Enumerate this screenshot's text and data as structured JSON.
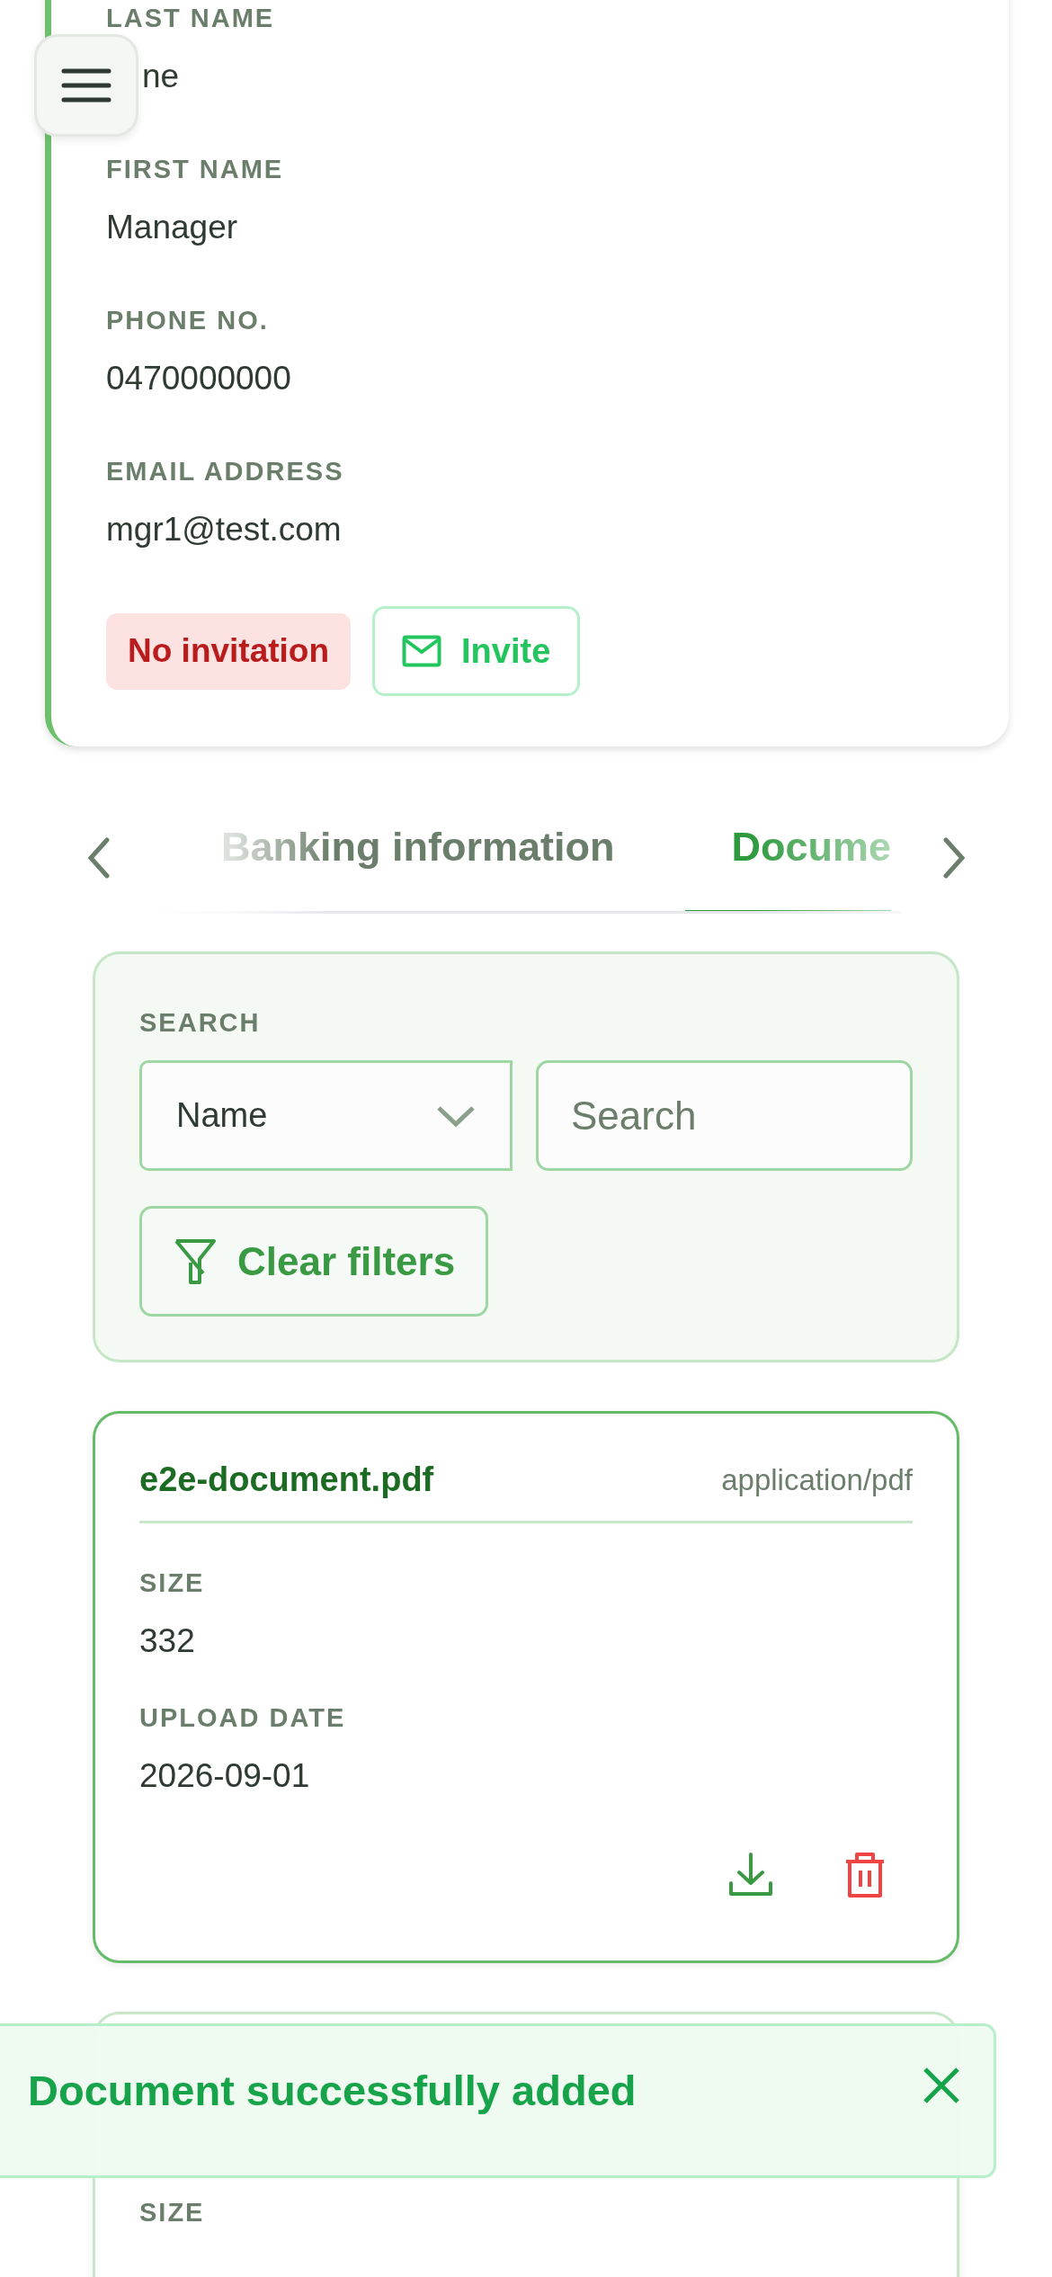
{
  "contact": {
    "fields": [
      {
        "label": "LAST NAME",
        "value": "ne"
      },
      {
        "label": "FIRST NAME",
        "value": "Manager"
      },
      {
        "label": "PHONE NO.",
        "value": "0470000000"
      },
      {
        "label": "EMAIL ADDRESS",
        "value": "mgr1@test.com"
      }
    ],
    "status_badge": "No invitation",
    "invite_button": "Invite"
  },
  "tabs": [
    {
      "label": "Banking information",
      "selected": false
    },
    {
      "label": "Docume",
      "selected": true
    }
  ],
  "filters": {
    "label": "SEARCH",
    "select": {
      "value": "Name"
    },
    "search": {
      "placeholder": "Search"
    },
    "clear_button": "Clear filters"
  },
  "documents": [
    {
      "name": "e2e-document.pdf",
      "type": "application/pdf",
      "fields": [
        {
          "label": "SIZE",
          "value": "332"
        },
        {
          "label": "UPLOAD DATE",
          "value": "2026-09-01"
        }
      ]
    },
    {
      "fields": [
        {
          "label": "SIZE"
        }
      ]
    }
  ],
  "toast": {
    "message": "Document successfully added"
  }
}
